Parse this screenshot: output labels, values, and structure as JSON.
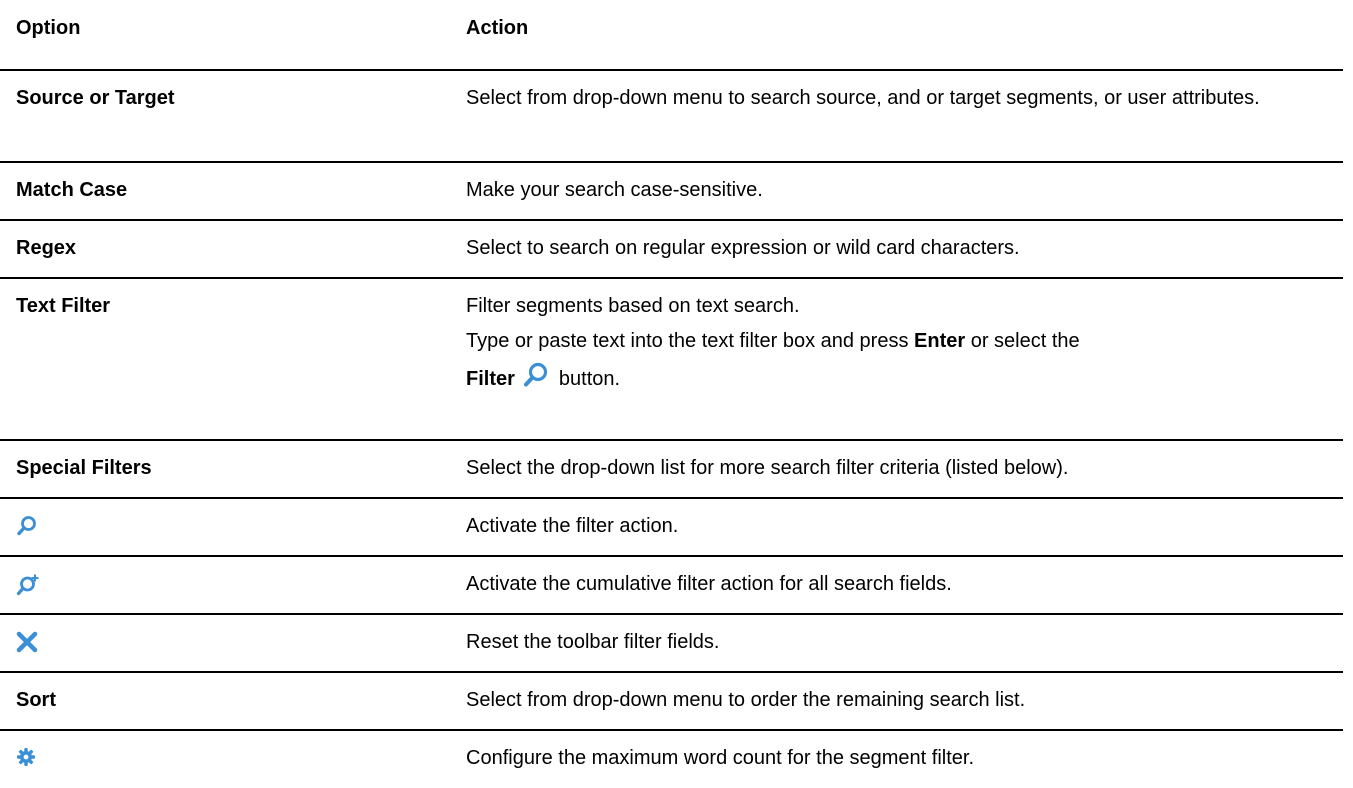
{
  "headers": {
    "option": "Option",
    "action": "Action"
  },
  "rows": [
    {
      "option": "Source or Target",
      "action": "Select from drop-down menu to search source, and or target segments, or user attributes."
    },
    {
      "option": "Match Case",
      "action": "Make your search case-sensitive."
    },
    {
      "option": "Regex",
      "action": "Select to search on regular expression or wild card characters."
    },
    {
      "option": "Text Filter",
      "action_line1": "Filter segments based on text search.",
      "action_line2_a": "Type or paste text into the text filter box and press ",
      "action_line2_bold": "Enter",
      "action_line2_b": " or select the",
      "action_line3_bold": "Filter",
      "action_line3_icon": "search-icon",
      "action_line3_b": "button."
    },
    {
      "option": "Special Filters",
      "action": "Select the drop-down list for more search filter criteria (listed below)."
    },
    {
      "icon": "search-icon",
      "action": "Activate the filter action."
    },
    {
      "icon": "cumulative-filter-icon",
      "action": "Activate the cumulative filter action for all search fields."
    },
    {
      "icon": "reset-x-icon",
      "action": "Reset the toolbar filter fields."
    },
    {
      "option": "Sort",
      "action": "Select from drop-down menu to order the remaining search list."
    },
    {
      "icon": "gear-icon",
      "action": "Configure the maximum word count for the segment filter."
    }
  ],
  "colors": {
    "icon_blue": "#3a8fd6",
    "rule": "#000000"
  }
}
